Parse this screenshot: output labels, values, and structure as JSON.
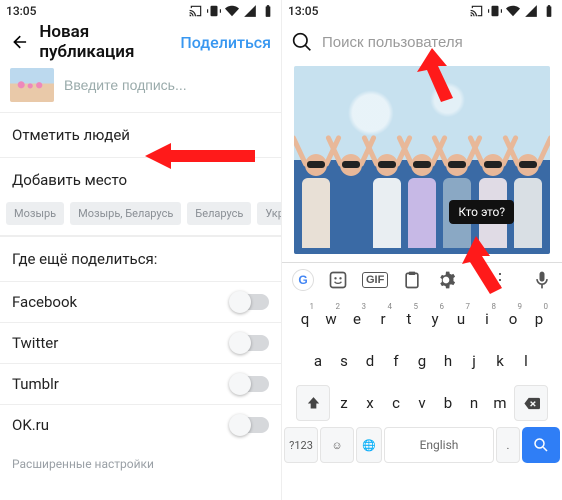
{
  "status": {
    "time": "13:05"
  },
  "left": {
    "title": "Новая публикация",
    "share": "Поделиться",
    "caption_placeholder": "Введите подпись...",
    "tag_people": "Отметить людей",
    "add_location": "Добавить место",
    "locations": [
      "Мозырь",
      "Мозырь, Беларусь",
      "Беларусь",
      "Украина"
    ],
    "share_also": "Где ещё поделиться:",
    "networks": [
      "Facebook",
      "Twitter",
      "Tumblr",
      "OK.ru"
    ],
    "advanced": "Расширенные настройки"
  },
  "right": {
    "search_placeholder": "Поиск пользователя",
    "bubble": "Кто это?",
    "space_label": "English",
    "numrow": "?123",
    "keys_top": [
      "q",
      "w",
      "e",
      "r",
      "t",
      "y",
      "u",
      "i",
      "o",
      "p"
    ],
    "keys_top_sup": [
      "1",
      "2",
      "3",
      "4",
      "5",
      "6",
      "7",
      "8",
      "9",
      "0"
    ],
    "keys_mid": [
      "a",
      "s",
      "d",
      "f",
      "g",
      "h",
      "j",
      "k",
      "l"
    ],
    "keys_bot": [
      "z",
      "x",
      "c",
      "v",
      "b",
      "n",
      "m"
    ]
  }
}
